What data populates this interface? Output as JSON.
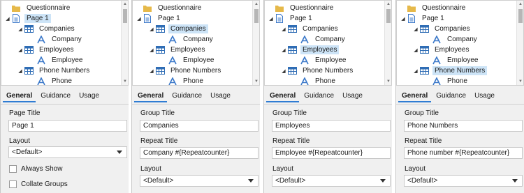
{
  "colors": {
    "accent": "#2f7cd3",
    "selection": "#cde4f7",
    "folder": "#e6b94a",
    "page": "#3b78c9",
    "table": "#2f6db5",
    "field": "#3b78c9"
  },
  "tree": {
    "root": "Questionnaire",
    "page": "Page 1",
    "items": [
      "Companies",
      "Company",
      "Employees",
      "Employee",
      "Phone Numbers",
      "Phone"
    ]
  },
  "tabs": [
    "General",
    "Guidance",
    "Usage"
  ],
  "panels": [
    {
      "selected": "page",
      "fields": {
        "title_label": "Page Title",
        "title_value": "Page 1",
        "layout_label": "Layout",
        "layout_value": "<Default>",
        "always_show": "Always Show",
        "collate_groups": "Collate Groups"
      }
    },
    {
      "selected": "companies",
      "fields": {
        "title_label": "Group Title",
        "title_value": "Companies",
        "repeat_label": "Repeat Title",
        "repeat_value": "Company #{Repeatcounter}",
        "layout_label": "Layout",
        "layout_value": "<Default>"
      }
    },
    {
      "selected": "employees",
      "fields": {
        "title_label": "Group Title",
        "title_value": "Employees",
        "repeat_label": "Repeat Title",
        "repeat_value": "Employee #{Repeatcounter}",
        "layout_label": "Layout",
        "layout_value": "<Default>"
      }
    },
    {
      "selected": "phone_numbers",
      "fields": {
        "title_label": "Group Title",
        "title_value": "Phone Numbers",
        "repeat_label": "Repeat Title",
        "repeat_value": "Phone number #{Repeatcounter}",
        "layout_label": "Layout",
        "layout_value": "<Default>"
      }
    }
  ]
}
